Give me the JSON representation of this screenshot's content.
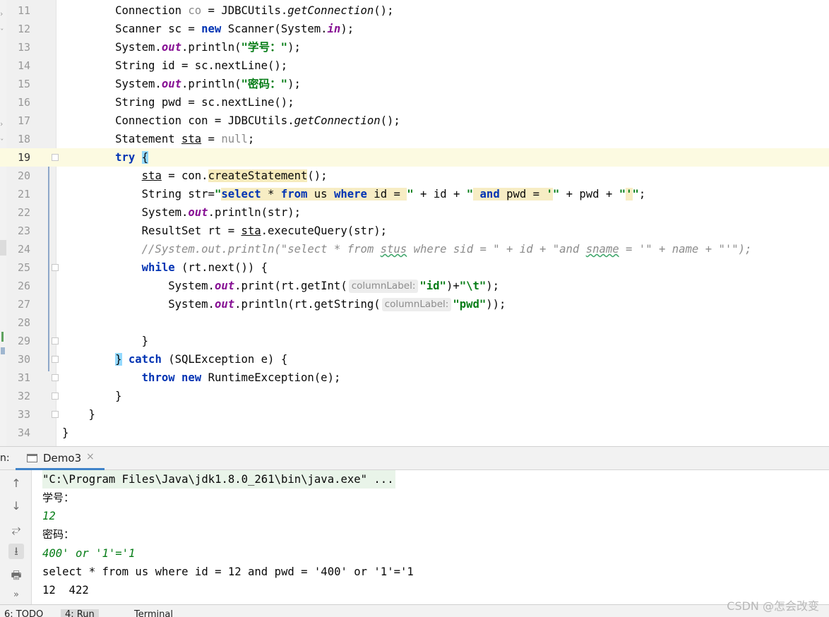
{
  "editor": {
    "lines": [
      {
        "n": "11",
        "segments": [
          {
            "t": "        Connection "
          },
          {
            "t": "co",
            "c": "gray"
          },
          {
            "t": " = JDBCUtils."
          },
          {
            "t": "getConnection",
            "c": "smeth"
          },
          {
            "t": "();"
          }
        ]
      },
      {
        "n": "12",
        "segments": [
          {
            "t": "        Scanner sc = "
          },
          {
            "t": "new",
            "c": "kw"
          },
          {
            "t": " Scanner(System."
          },
          {
            "t": "in",
            "c": "sfield"
          },
          {
            "t": ");"
          }
        ]
      },
      {
        "n": "13",
        "segments": [
          {
            "t": "        System."
          },
          {
            "t": "out",
            "c": "sfield"
          },
          {
            "t": ".println("
          },
          {
            "t": "\"学号：\"",
            "c": "str"
          },
          {
            "t": ");"
          }
        ]
      },
      {
        "n": "14",
        "segments": [
          {
            "t": "        String id = sc.nextLine();"
          }
        ]
      },
      {
        "n": "15",
        "segments": [
          {
            "t": "        System."
          },
          {
            "t": "out",
            "c": "sfield"
          },
          {
            "t": ".println("
          },
          {
            "t": "\"密码：\"",
            "c": "str"
          },
          {
            "t": ");"
          }
        ]
      },
      {
        "n": "16",
        "segments": [
          {
            "t": "        String pwd = sc.nextLine();"
          }
        ]
      },
      {
        "n": "17",
        "segments": [
          {
            "t": "        Connection con = JDBCUtils."
          },
          {
            "t": "getConnection",
            "c": "smeth"
          },
          {
            "t": "();"
          }
        ]
      },
      {
        "n": "18",
        "segments": [
          {
            "t": "        Statement "
          },
          {
            "t": "sta",
            "c": "uline"
          },
          {
            "t": " = "
          },
          {
            "t": "null",
            "c": "gray"
          },
          {
            "t": ";"
          }
        ]
      },
      {
        "n": "19",
        "current": true,
        "segments": [
          {
            "t": "        "
          },
          {
            "t": "try",
            "c": "kw"
          },
          {
            "t": " "
          },
          {
            "t": "{",
            "c": "brace-hl"
          }
        ]
      },
      {
        "n": "20",
        "segments": [
          {
            "t": "            "
          },
          {
            "t": "sta",
            "c": "uline"
          },
          {
            "t": " = con."
          },
          {
            "t": "createStatement",
            "c": "hl"
          },
          {
            "t": "();"
          }
        ]
      },
      {
        "n": "21",
        "segments": [
          {
            "t": "            String str="
          },
          {
            "t": "\"",
            "c": "str"
          },
          {
            "t": "select",
            "c": "kw sqlhl"
          },
          {
            "t": " * ",
            "c": "sqlhl"
          },
          {
            "t": "from",
            "c": "kw sqlhl"
          },
          {
            "t": " us ",
            "c": "sqlhl"
          },
          {
            "t": "where",
            "c": "kw sqlhl"
          },
          {
            "t": " id = ",
            "c": "sqlhl"
          },
          {
            "t": "\"",
            "c": "str"
          },
          {
            "t": " + id + "
          },
          {
            "t": "\"",
            "c": "str"
          },
          {
            "t": " ",
            "c": "sqlhl"
          },
          {
            "t": "and",
            "c": "kw sqlhl"
          },
          {
            "t": " pwd = ",
            "c": "sqlhl"
          },
          {
            "t": "'",
            "c": "str sqlhl"
          },
          {
            "t": "\"",
            "c": "str"
          },
          {
            "t": " + pwd + "
          },
          {
            "t": "\"",
            "c": "str"
          },
          {
            "t": "'",
            "c": "str sqlhl"
          },
          {
            "t": "\"",
            "c": "str"
          },
          {
            "t": ";"
          }
        ]
      },
      {
        "n": "22",
        "segments": [
          {
            "t": "            System."
          },
          {
            "t": "out",
            "c": "sfield"
          },
          {
            "t": ".println(str);"
          }
        ]
      },
      {
        "n": "23",
        "segments": [
          {
            "t": "            ResultSet rt = "
          },
          {
            "t": "sta",
            "c": "uline"
          },
          {
            "t": ".executeQuery(str);"
          }
        ]
      },
      {
        "n": "24",
        "segments": [
          {
            "t": "            //System.out.println(\"select * from ",
            "c": "cmt"
          },
          {
            "t": "stus",
            "c": "cmt wavy"
          },
          {
            "t": " where sid = \" + id + \"and ",
            "c": "cmt"
          },
          {
            "t": "sname",
            "c": "cmt wavy"
          },
          {
            "t": " = '\" + name + \"'\");",
            "c": "cmt"
          }
        ]
      },
      {
        "n": "25",
        "segments": [
          {
            "t": "            "
          },
          {
            "t": "while",
            "c": "kw"
          },
          {
            "t": " (rt.next()) {"
          }
        ]
      },
      {
        "n": "26",
        "segments": [
          {
            "t": "                System."
          },
          {
            "t": "out",
            "c": "sfield"
          },
          {
            "t": ".print(rt.getInt("
          },
          {
            "t": "columnLabel:",
            "c": "hint"
          },
          {
            "t": "\"id\"",
            "c": "str"
          },
          {
            "t": ")+"
          },
          {
            "t": "\"\\t\"",
            "c": "str"
          },
          {
            "t": ");"
          }
        ]
      },
      {
        "n": "27",
        "segments": [
          {
            "t": "                System."
          },
          {
            "t": "out",
            "c": "sfield"
          },
          {
            "t": ".println(rt.getString("
          },
          {
            "t": "columnLabel:",
            "c": "hint"
          },
          {
            "t": "\"pwd\"",
            "c": "str"
          },
          {
            "t": "));"
          }
        ]
      },
      {
        "n": "28",
        "segments": [
          {
            "t": ""
          }
        ]
      },
      {
        "n": "29",
        "segments": [
          {
            "t": "            }"
          }
        ]
      },
      {
        "n": "30",
        "segments": [
          {
            "t": "        "
          },
          {
            "t": "}",
            "c": "brace-hl"
          },
          {
            "t": " "
          },
          {
            "t": "catch",
            "c": "kw"
          },
          {
            "t": " (SQLException e) {"
          }
        ]
      },
      {
        "n": "31",
        "segments": [
          {
            "t": "            "
          },
          {
            "t": "throw",
            "c": "kw"
          },
          {
            "t": " "
          },
          {
            "t": "new",
            "c": "kw"
          },
          {
            "t": " RuntimeException(e);"
          }
        ]
      },
      {
        "n": "32",
        "segments": [
          {
            "t": "        }"
          }
        ]
      },
      {
        "n": "33",
        "segments": [
          {
            "t": "    }"
          }
        ]
      },
      {
        "n": "34",
        "segments": [
          {
            "t": "}"
          }
        ]
      }
    ]
  },
  "run_panel": {
    "label": "n:",
    "tab_label": "Demo3",
    "tab_close": "×",
    "toolbar": [
      "↑",
      "↓",
      "⥂",
      "⭳",
      "🖶",
      "»"
    ],
    "console": [
      {
        "t": "\"C:\\Program Files\\Java\\jdk1.8.0_261\\bin\\java.exe\" ...",
        "k": "cmd"
      },
      {
        "t": "学号：",
        "k": "cjk"
      },
      {
        "t": "12",
        "k": "input"
      },
      {
        "t": "密码：",
        "k": "cjk"
      },
      {
        "t": "400' or '1'='1",
        "k": "input"
      },
      {
        "t": "select * from us where id = 12 and pwd = '400' or '1'='1",
        "k": "out"
      },
      {
        "t": "12  422",
        "k": "out"
      }
    ]
  },
  "bottom_bar": {
    "todo": "6: TODO",
    "run": "4: Run",
    "terminal": "Terminal"
  },
  "watermark": "CSDN @怎会改变"
}
